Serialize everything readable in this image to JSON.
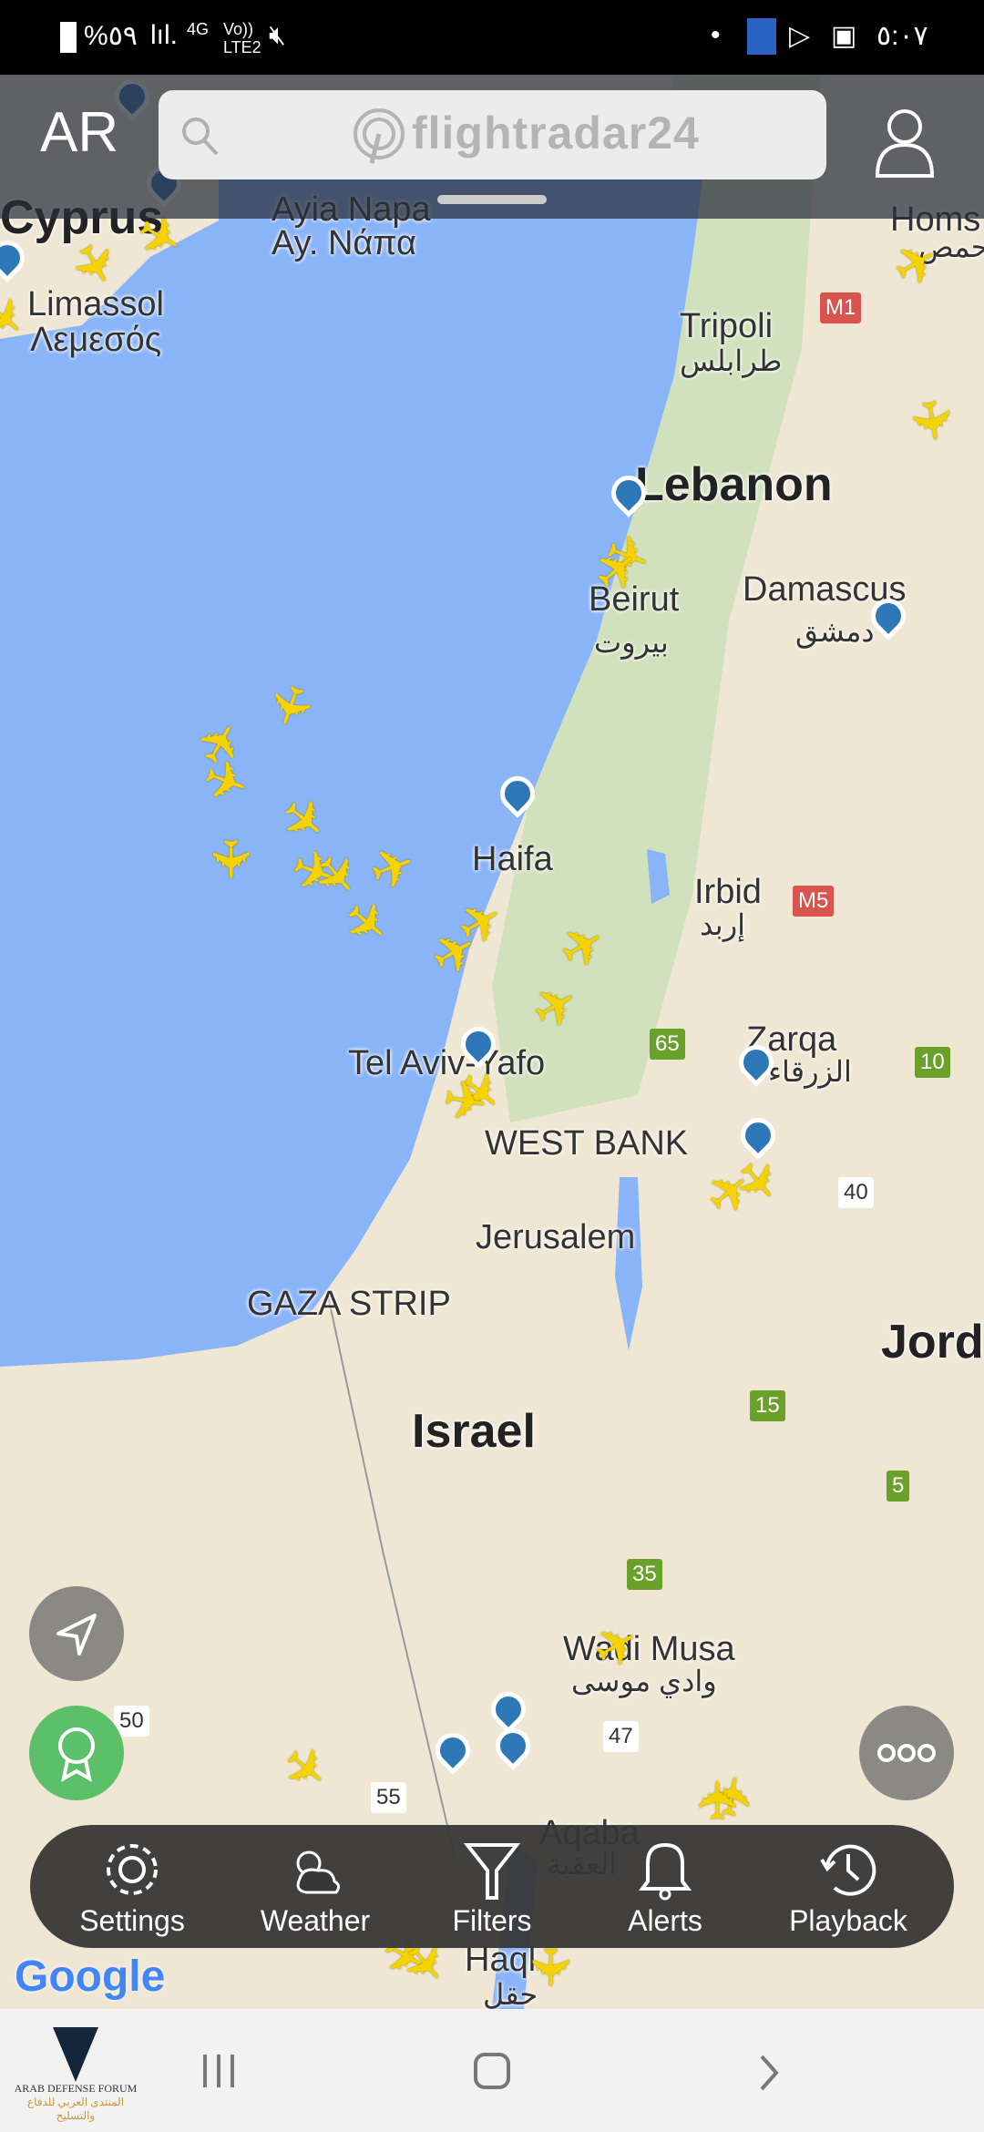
{
  "status_bar": {
    "battery": "%٥٩",
    "network": "4G",
    "volte": "Vo)) LTE2",
    "time": "٥:٠٧",
    "icons": [
      "battery-icon",
      "signal-icon",
      "mute-icon",
      "word-icon",
      "play-store-icon",
      "gallery-icon"
    ]
  },
  "header": {
    "ar_label": "AR",
    "search_placeholder": "flightradar24",
    "icons": [
      "search-icon",
      "radar-logo-icon",
      "profile-icon"
    ]
  },
  "map": {
    "labels": [
      {
        "t": "Cyprus",
        "c": "big"
      },
      {
        "t": "Ayia Napa"
      },
      {
        "t": "Ay. Νάπα"
      },
      {
        "t": "Homs"
      },
      {
        "t": "Limassol"
      },
      {
        "t": "Λεμεσός"
      },
      {
        "t": "Tripoli"
      },
      {
        "t": "طرابلس"
      },
      {
        "t": "Lebanon",
        "c": "big"
      },
      {
        "t": "Beirut"
      },
      {
        "t": "بيروت"
      },
      {
        "t": "Damascus"
      },
      {
        "t": "دمشق"
      },
      {
        "t": "Haifa"
      },
      {
        "t": "Irbid"
      },
      {
        "t": "إربد"
      },
      {
        "t": "Tel Aviv-Yafo"
      },
      {
        "t": "Zarqa"
      },
      {
        "t": "الزرقاء"
      },
      {
        "t": "WEST BANK"
      },
      {
        "t": "Jerusalem"
      },
      {
        "t": "GAZA STRIP"
      },
      {
        "t": "Jord",
        "c": "big"
      },
      {
        "t": "Israel",
        "c": "big"
      },
      {
        "t": "Wadi Musa"
      },
      {
        "t": "وادي موسى"
      },
      {
        "t": "Aqaba"
      },
      {
        "t": "العقبة"
      },
      {
        "t": "Haql"
      },
      {
        "t": "حقل"
      },
      {
        "t": "حمص"
      }
    ],
    "road_shields": [
      "M1",
      "M5",
      "65",
      "10",
      "40",
      "15",
      "5",
      "35",
      "47",
      "50",
      "55"
    ],
    "attribution": "Google"
  },
  "toolbar": {
    "items": [
      {
        "label": "Settings",
        "icon": "gear-icon"
      },
      {
        "label": "Weather",
        "icon": "weather-icon"
      },
      {
        "label": "Filters",
        "icon": "filter-icon"
      },
      {
        "label": "Alerts",
        "icon": "bell-icon"
      },
      {
        "label": "Playback",
        "icon": "history-icon"
      }
    ]
  },
  "fabs": {
    "locate": "navigation-arrow-icon",
    "badge": "award-icon",
    "more": "more-icon",
    "badge_color": "#5cbf6a"
  },
  "nav": {
    "watermark": "ARAB DEFENSE FORUM",
    "watermark_ar": "المنتدى العربي للدفاع والتسليح"
  },
  "colors": {
    "plane": "#f5d300",
    "pin": "#2f78b7",
    "sea": "#8ab4f8"
  }
}
